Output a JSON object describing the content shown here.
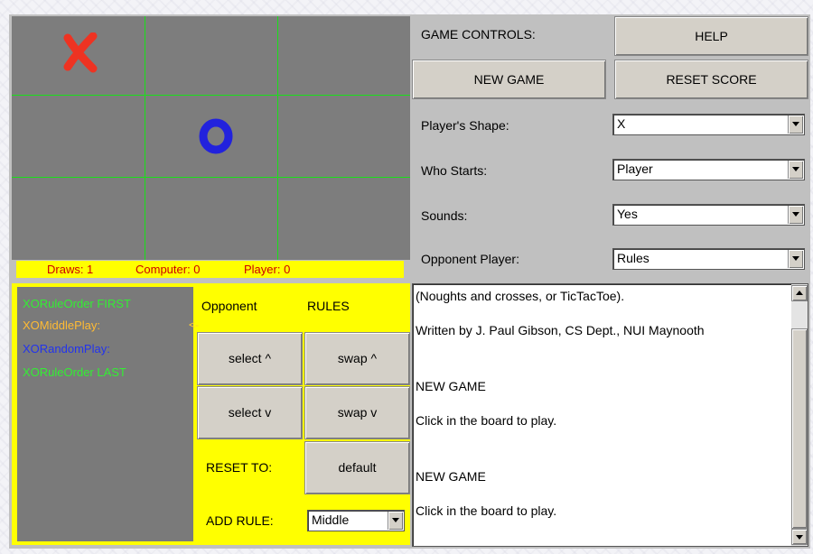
{
  "board": {
    "cells": [
      "X",
      "",
      "",
      "",
      "O",
      "",
      "",
      "",
      ""
    ],
    "colors": {
      "x": "#ee3322",
      "o": "#2222dd",
      "grid": "#19e019",
      "background": "#7d7d7d"
    }
  },
  "score": {
    "draws": "Draws: 1",
    "computer": "Computer: 0",
    "player": "Player: 0"
  },
  "rules_panel": {
    "rules": [
      {
        "name": "XORuleOrder FIRST",
        "color": "#33ee33"
      },
      {
        "name": "XOMiddlePlay:",
        "color": "#ffbb33"
      },
      {
        "name": "XORandomPlay:",
        "color": "#2233ee"
      },
      {
        "name": "XORuleOrder LAST",
        "color": "#33ee33"
      }
    ],
    "selected_arrow": "<-",
    "opponent_label": "Opponent",
    "rules_label": "RULES",
    "select_up": "select ^",
    "swap_up": "swap ^",
    "select_down": "select v",
    "swap_down": "swap v",
    "reset_to_label": "RESET TO:",
    "default_button": "default",
    "add_rule_label": "ADD RULE:",
    "add_rule_value": "Middle"
  },
  "controls": {
    "game_controls_label": "GAME CONTROLS:",
    "help_button": "HELP",
    "new_game_button": "NEW GAME",
    "reset_score_button": "RESET SCORE",
    "shape_label": "Player's Shape:",
    "shape_value": "X",
    "starts_label": "Who Starts:",
    "starts_value": "Player",
    "sounds_label": "Sounds:",
    "sounds_value": "Yes",
    "opponent_label": "Opponent Player:",
    "opponent_value": "Rules"
  },
  "log": {
    "lines": [
      "(Noughts and crosses, or TicTacToe).",
      "Written by J. Paul Gibson, CS Dept., NUI Maynooth",
      "NEW GAME",
      "Click in the board to play.",
      "NEW GAME",
      "Click in the board to play."
    ]
  }
}
